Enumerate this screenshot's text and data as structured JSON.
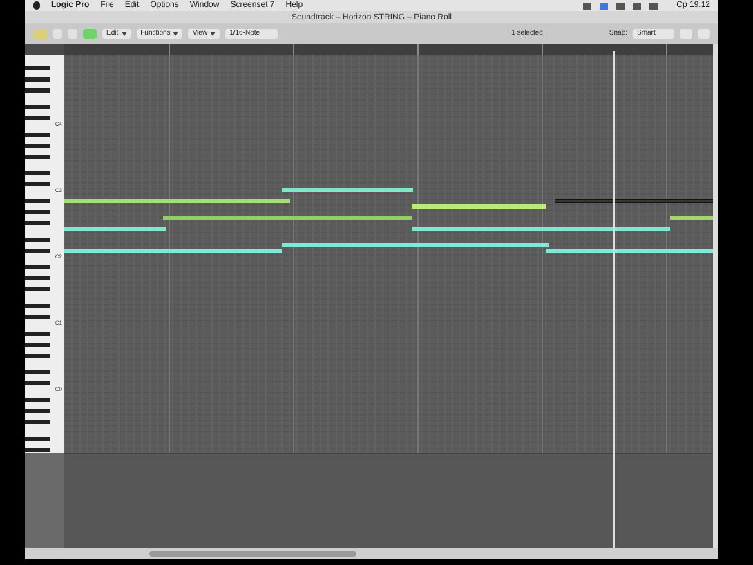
{
  "menu_bar": {
    "app": "Logic Pro",
    "items": [
      "File",
      "Edit",
      "Options",
      "Window",
      "Screenset 7",
      "Help"
    ],
    "clock": "Ср 19:12"
  },
  "window": {
    "title": "Soundtrack – Horizon STRING – Piano Roll"
  },
  "toolbar": {
    "menus": [
      "Edit",
      "Functions",
      "View"
    ],
    "quantize": "1/16-Note",
    "selection": "1 selected",
    "snap_label": "Snap:",
    "snap": "Smart"
  },
  "keyboard": {
    "labels": [
      "C4",
      "C3",
      "C2",
      "C1",
      "C0"
    ]
  },
  "notes": [
    {
      "color": "#7fe6c8",
      "selected": false
    },
    {
      "color": "#9fe07a",
      "selected": false
    },
    {
      "color": "#2f3a2a",
      "selected": true
    },
    {
      "color": "#b8ea7c",
      "selected": false
    },
    {
      "color": "#8fcf6a",
      "selected": false
    },
    {
      "color": "#9fd66e",
      "selected": false
    },
    {
      "color": "#7fe6d0",
      "selected": false
    },
    {
      "color": "#7fe6d0",
      "selected": false
    },
    {
      "color": "#7fe8d8",
      "selected": false
    },
    {
      "color": "#7fe8d8",
      "selected": false
    },
    {
      "color": "#7fe8d8",
      "selected": false
    }
  ]
}
